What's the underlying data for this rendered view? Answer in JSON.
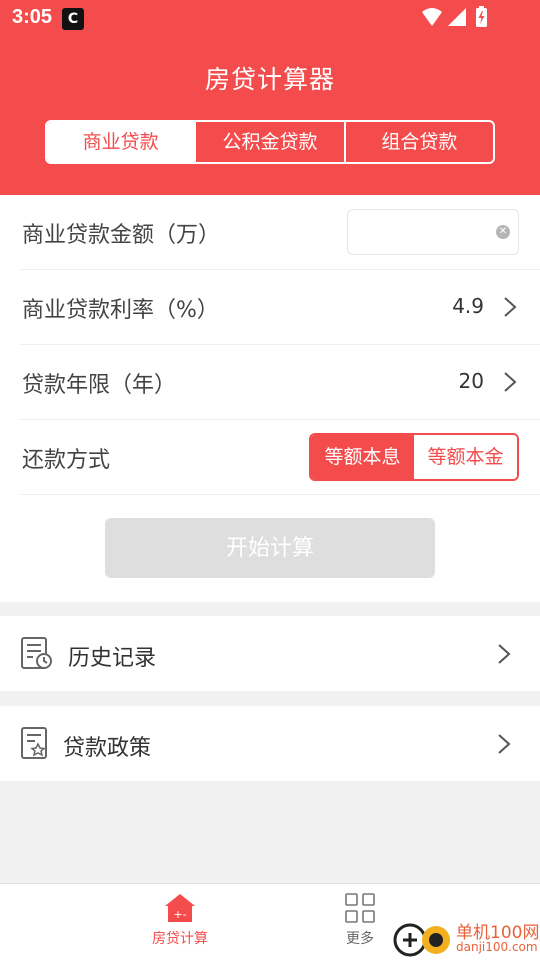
{
  "status": {
    "time": "3:05",
    "app_icon_glyph": "C"
  },
  "header": {
    "title": "房贷计算器",
    "tabs": [
      {
        "label": "商业贷款",
        "active": true
      },
      {
        "label": "公积金贷款",
        "active": false
      },
      {
        "label": "组合贷款",
        "active": false
      }
    ]
  },
  "form": {
    "amount_label": "商业贷款金额（万）",
    "amount_value": "",
    "rate_label": "商业贷款利率（%）",
    "rate_value": "4.9",
    "term_label": "贷款年限（年）",
    "term_value": "20",
    "method_label": "还款方式",
    "methods": [
      {
        "label": "等额本息",
        "active": true
      },
      {
        "label": "等额本金",
        "active": false
      }
    ],
    "calc_button": "开始计算"
  },
  "menu": {
    "history": "历史记录",
    "policy": "贷款政策"
  },
  "nav": {
    "home": "房贷计算",
    "more": "更多"
  },
  "watermark": {
    "line1": "单机100网",
    "line2": "danji100.com"
  },
  "colors": {
    "accent": "#f44c4c",
    "disabled_button": "#dedede"
  }
}
